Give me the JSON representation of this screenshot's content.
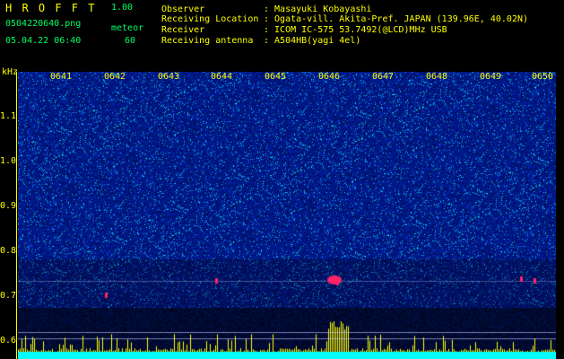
{
  "app": {
    "title": "H R O F F T",
    "version": "1.00"
  },
  "info": {
    "filename": "0504220640.png",
    "datetime": "05.04.22 06:40",
    "count_label": "meteor",
    "count_value": "60"
  },
  "header": {
    "rows": [
      {
        "label": "Observer",
        "value": ": Masayuki Kobayashi"
      },
      {
        "label": "Receiving Location",
        "value": ": Ogata-vill. Akita-Pref. JAPAN (139.96E, 40.02N)"
      },
      {
        "label": "Receiver",
        "value": ": ICOM IC-575 53.7492(@LCD)MHz USB"
      },
      {
        "label": "Receiving antenna",
        "value": ": A504HB(yagi 4el)"
      }
    ]
  },
  "axis": {
    "unit": "kHz",
    "freq_ticks": [
      "1.1",
      "1.0",
      "0.9",
      "0.8",
      "0.7",
      "0.6"
    ],
    "time_ticks": [
      "0641",
      "0642",
      "0643",
      "0644",
      "0645",
      "0646",
      "0647",
      "0648",
      "0649",
      "0650"
    ]
  },
  "colors": {
    "background": "#000000",
    "label": "#ffff00",
    "info": "#00ff66",
    "signal": "#ff2266",
    "level": "#ffff00",
    "noise_floor": "#00ffff"
  }
}
